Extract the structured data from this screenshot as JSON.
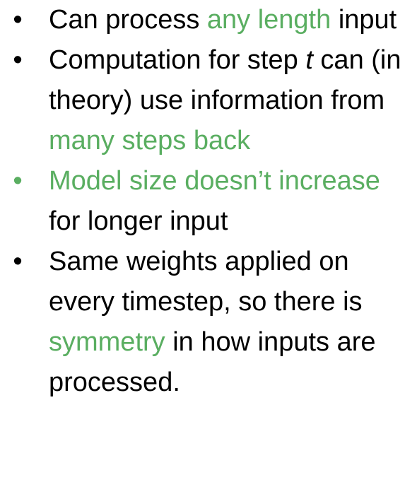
{
  "colors": {
    "text": "#000000",
    "highlight": "#5aae61"
  },
  "bullet_glyph": "•",
  "bullets": [
    {
      "dot_color": "black",
      "segments": [
        {
          "text": "Can process ",
          "style": "plain"
        },
        {
          "text": "any length",
          "style": "green"
        },
        {
          "text": " input",
          "style": "plain"
        }
      ]
    },
    {
      "dot_color": "black",
      "segments": [
        {
          "text": "Computation for step ",
          "style": "plain"
        },
        {
          "text": "t",
          "style": "italic"
        },
        {
          "text": " can (in theory) use information from ",
          "style": "plain"
        },
        {
          "text": "many steps back",
          "style": "green"
        }
      ]
    },
    {
      "dot_color": "green",
      "segments": [
        {
          "text": "Model size doesn’t increase",
          "style": "green"
        },
        {
          "text": " for longer input",
          "style": "plain"
        }
      ]
    },
    {
      "dot_color": "black",
      "segments": [
        {
          "text": "Same weights applied on every timestep, so there is ",
          "style": "plain"
        },
        {
          "text": "symmetry",
          "style": "green"
        },
        {
          "text": " in how inputs are processed.",
          "style": "plain"
        }
      ]
    }
  ]
}
